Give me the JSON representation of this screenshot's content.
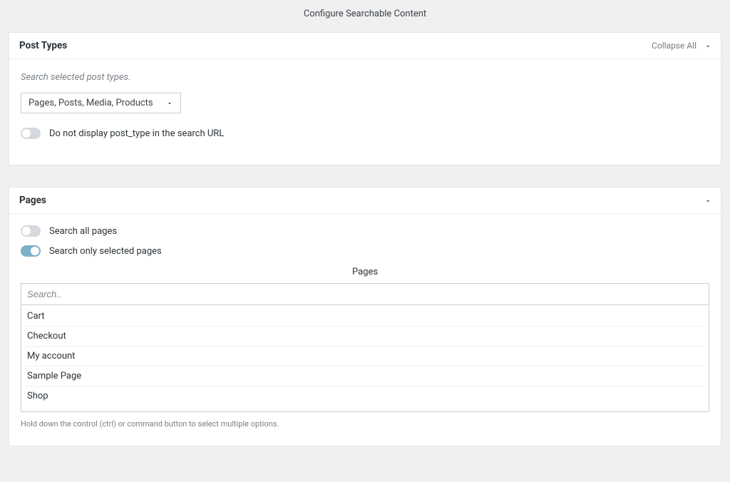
{
  "page": {
    "title": "Configure Searchable Content"
  },
  "post_types_panel": {
    "title": "Post Types",
    "collapse_label": "Collapse All",
    "hint": "Search selected post types.",
    "select_value": "Pages, Posts, Media, Products",
    "toggle_hide_url": {
      "label": "Do not display post_type in the search URL",
      "on": false
    }
  },
  "pages_panel": {
    "title": "Pages",
    "toggle_all": {
      "label": "Search all pages",
      "on": false
    },
    "toggle_selected": {
      "label": "Search only selected pages",
      "on": true
    },
    "sub_title": "Pages",
    "search_placeholder": "Search..",
    "items": [
      "Cart",
      "Checkout",
      "My account",
      "Sample Page",
      "Shop"
    ],
    "footer_hint": "Hold down the control (ctrl) or command button to select multiple options."
  }
}
